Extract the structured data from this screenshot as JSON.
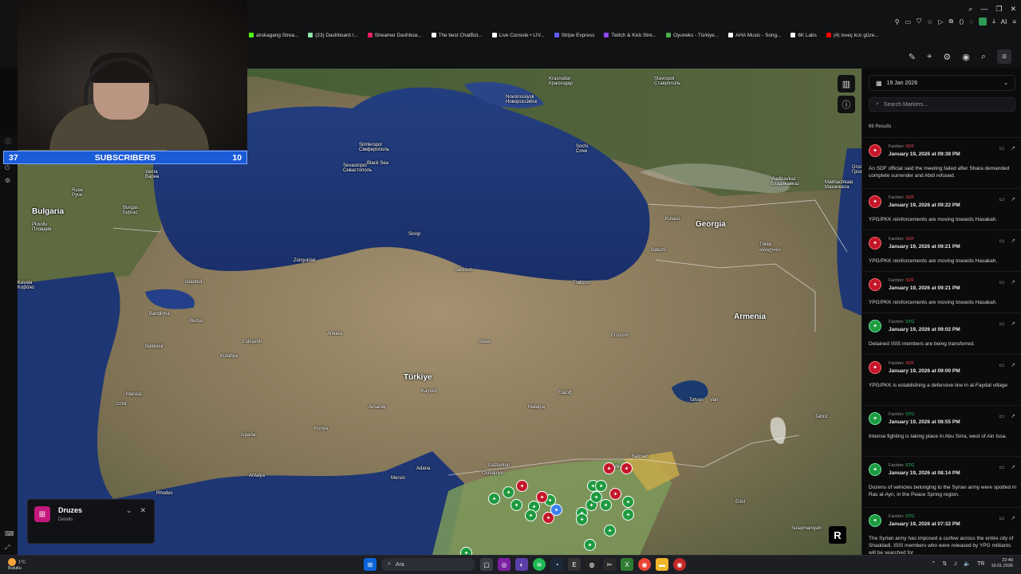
{
  "browser": {
    "bookmarks": [
      {
        "label": "alıskagang Strea...",
        "color": "#53fc18"
      },
      {
        "label": "(23) Dashboard /...",
        "color": "#8ee6a6"
      },
      {
        "label": "Streamer Dashboa...",
        "color": "#e91e63"
      },
      {
        "label": "The best ChatBot...",
        "color": "#ffffff"
      },
      {
        "label": "Live Console • LIV...",
        "color": "#ffffff"
      },
      {
        "label": "Stripe Express",
        "color": "#635bff"
      },
      {
        "label": "Twitch & Kick Stre...",
        "color": "#9146ff"
      },
      {
        "label": "Oyuneks - Türkiye...",
        "color": "#4caf50"
      },
      {
        "label": "AHA Music - Song...",
        "color": "#ffffff"
      },
      {
        "label": "6K Labs",
        "color": "#ffffff"
      },
      {
        "label": "(4) isveç kızı güze...",
        "color": "#ff0000"
      }
    ],
    "ai_label": "AI"
  },
  "stream": {
    "sub_current": "37",
    "sub_label": "SUBSCRIBERS",
    "sub_goal": "10"
  },
  "map": {
    "labels": [
      {
        "text": "Bulgaria",
        "big": true
      },
      {
        "text": "Türkiye",
        "big": true
      },
      {
        "text": "Georgia",
        "big": true
      },
      {
        "text": "Armenia",
        "big": true
      },
      {
        "text": "Black Sea",
        "big": false
      },
      {
        "text": "Sevastopol\nСевастополь",
        "big": false
      },
      {
        "text": "Simferopol\nСімферополь",
        "big": false
      },
      {
        "text": "Krasnodar\nКраснодар",
        "big": false
      },
      {
        "text": "Stavropol\nСтаврополь",
        "big": false
      },
      {
        "text": "Novorossiysk\nНовороссийск",
        "big": false
      },
      {
        "text": "Sochi\nСочи",
        "big": false
      },
      {
        "text": "Grozny\nГрозный",
        "big": false
      },
      {
        "text": "Vladikavkaz\nВладикавказ",
        "big": false
      },
      {
        "text": "Makhachkala\nМахачкала",
        "big": false
      },
      {
        "text": "Tbilisi\nთბილისი",
        "big": false
      },
      {
        "text": "Kutaisi",
        "big": false
      },
      {
        "text": "Batumi",
        "big": false
      },
      {
        "text": "Trabzon",
        "big": false
      },
      {
        "text": "Samsun",
        "big": false
      },
      {
        "text": "Sinop",
        "big": false
      },
      {
        "text": "Zonguldak",
        "big": false
      },
      {
        "text": "Istanbul",
        "big": false
      },
      {
        "text": "Bursa",
        "big": false
      },
      {
        "text": "Balıkesir",
        "big": false
      },
      {
        "text": "Eskişehir",
        "big": false
      },
      {
        "text": "Ankara",
        "big": false
      },
      {
        "text": "Kayseri",
        "big": false
      },
      {
        "text": "Sivas",
        "big": false
      },
      {
        "text": "Erzurum",
        "big": false
      },
      {
        "text": "Elazığ",
        "big": false
      },
      {
        "text": "Malatya",
        "big": false
      },
      {
        "text": "Konya",
        "big": false
      },
      {
        "text": "Antalya",
        "big": false
      },
      {
        "text": "İzmir",
        "big": false
      },
      {
        "text": "Manisa",
        "big": false
      },
      {
        "text": "Aksaray",
        "big": false
      },
      {
        "text": "Adana",
        "big": false
      },
      {
        "text": "Mersin",
        "big": false
      },
      {
        "text": "Gaziantep",
        "big": false
      },
      {
        "text": "Osmaniye",
        "big": false
      },
      {
        "text": "Mardin",
        "big": false
      },
      {
        "text": "Batman",
        "big": false
      },
      {
        "text": "Van",
        "big": false
      },
      {
        "text": "Tatvan",
        "big": false
      },
      {
        "text": "Tabriz",
        "big": false
      },
      {
        "text": "Erbil",
        "big": false
      },
      {
        "text": "Rhodes",
        "big": false
      },
      {
        "text": "Varna\nВарна",
        "big": false
      },
      {
        "text": "Plovdiv\nПловдив",
        "big": false
      },
      {
        "text": "Burgas\nБургас",
        "big": false
      },
      {
        "text": "Ruse\nРусе",
        "big": false
      },
      {
        "text": "Kavala\nΚαβάλα",
        "big": false
      },
      {
        "text": "Bandirma",
        "big": false
      },
      {
        "text": "Kütahya",
        "big": false
      },
      {
        "text": "Isparta",
        "big": false
      },
      {
        "text": "Sulaymaniyah",
        "big": false
      }
    ],
    "druzes_title": "Druzes",
    "druzes_sub": "Details",
    "badge": "R"
  },
  "panel": {
    "date": "19 Jan 2026",
    "search_placeholder": "Search Markers...",
    "results": "66 Results",
    "faction_prefix": "Faction:",
    "items": [
      {
        "faction": "SDF",
        "date": "January 19, 2026 at 09:38 PM",
        "text": "An SDF official said the meeting failed after Shara demanded complete surrender and Abdi refused.",
        "color": "r"
      },
      {
        "faction": "SDF",
        "date": "January 19, 2026 at 09:22 PM",
        "text": "YPG/PKK reinforcements are moving towards Hasakah.",
        "color": "r"
      },
      {
        "faction": "SDF",
        "date": "January 19, 2026 at 09:21 PM",
        "text": "YPG/PKK reinforcements are moving towards Hasakah.",
        "color": "r"
      },
      {
        "faction": "SDF",
        "date": "January 19, 2026 at 09:21 PM",
        "text": "YPG/PKK reinforcements are moving towards Hasakah.",
        "color": "r"
      },
      {
        "faction": "STG",
        "date": "January 19, 2026 at 09:02 PM",
        "text": "Detained ISIS members are being transferred.",
        "color": "g"
      },
      {
        "faction": "SDF",
        "date": "January 19, 2026 at 09:00 PM",
        "text": "YPG/PKK is establishing a defensive line in al-Faydat village",
        "color": "r"
      },
      {
        "faction": "STG",
        "date": "January 19, 2026 at 08:55 PM",
        "text": "Intense fighting is taking place in Abu Sirra, west of Ain Issa.",
        "color": "g"
      },
      {
        "faction": "STG",
        "date": "January 19, 2026 at 08:14 PM",
        "text": "Dozens of vehicles belonging to the Syrian army were spotted in Ras al-Ayn, in the Peace Spring region.",
        "color": "g"
      },
      {
        "faction": "STG",
        "date": "January 19, 2026 at 07:32 PM",
        "text": "The Syrian army has imposed a curfew across the entire city of Shaddadi. ISIS members who were released by YPG militants will be searched for",
        "color": "g"
      }
    ]
  },
  "taskbar": {
    "weather_temp": "1°C",
    "weather_desc": "Bulutlu",
    "search_label": "Ara",
    "time": "22:49",
    "date": "19.01.2026"
  }
}
